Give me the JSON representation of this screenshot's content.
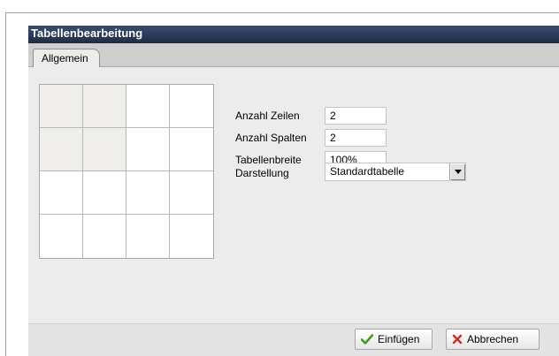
{
  "window": {
    "title": "Tabellenbearbeitung"
  },
  "tabs": [
    {
      "label": "Allgemein",
      "active": true
    }
  ],
  "table_preview": {
    "rows": 4,
    "cols": 4,
    "selected_rows": 2,
    "selected_cols": 2
  },
  "form": {
    "rows": {
      "label": "Anzahl Zeilen",
      "value": "2"
    },
    "cols": {
      "label": "Anzahl Spalten",
      "value": "2"
    },
    "width": {
      "label": "Tabellenbreite",
      "value": "100%"
    },
    "display": {
      "label": "Darstellung",
      "value": "Standardtabelle"
    }
  },
  "buttons": {
    "insert": {
      "label": "Einfügen",
      "icon": "checkmark-icon",
      "color": "#3a9b1f"
    },
    "cancel": {
      "label": "Abbrechen",
      "icon": "x-icon",
      "color": "#d22a1f"
    }
  },
  "colors": {
    "titlebar": "#2a3a5a",
    "selected_cell": "#efeeea"
  }
}
